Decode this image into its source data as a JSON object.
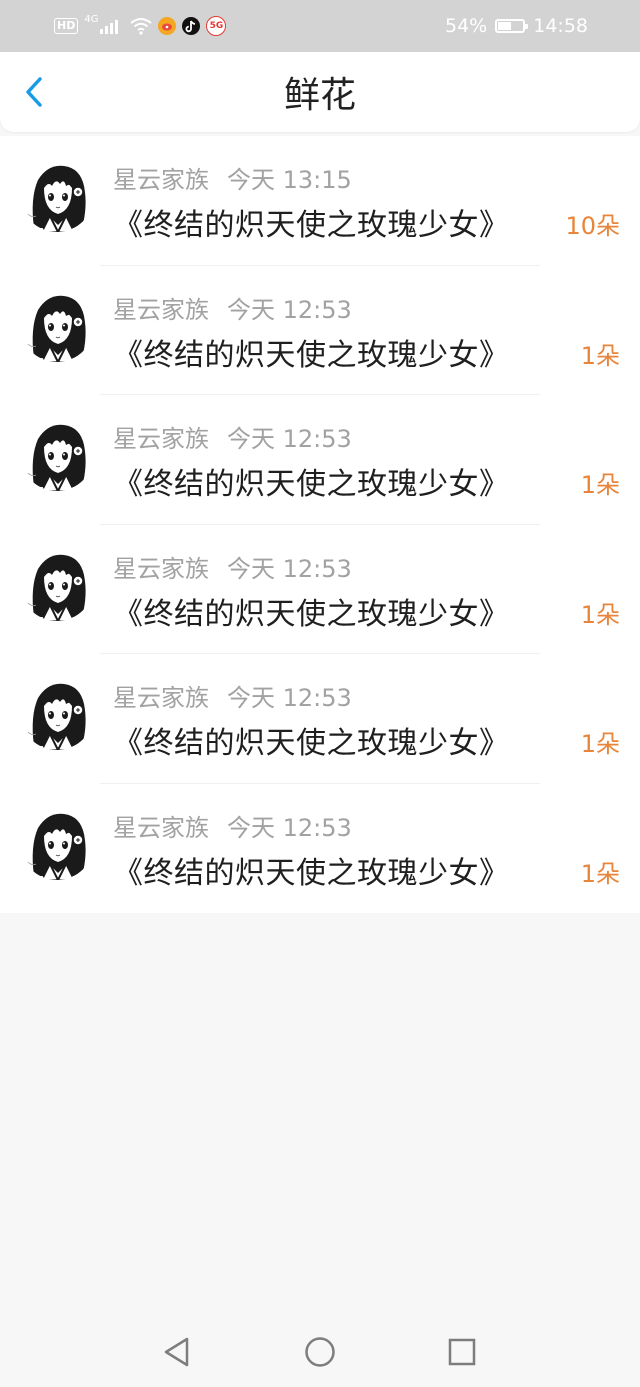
{
  "status_bar": {
    "hd": "HD",
    "network": "4G",
    "battery": "54%",
    "battery_level": 0.54,
    "time": "14:58",
    "app_icons": [
      "weibo-icon",
      "tiktok-icon",
      "5g-icon"
    ],
    "fiveg": "5G"
  },
  "header": {
    "title": "鲜花",
    "back_icon": "chevron-left-icon",
    "accent_color": "#1a9be6"
  },
  "colors": {
    "count": "#e8853a",
    "meta": "#a2a2a2",
    "title": "#1f1f1f"
  },
  "items": [
    {
      "name": "星云家族",
      "time": "今天 13:15",
      "title": "《终结的炽天使之玫瑰少女》",
      "count": "10朵"
    },
    {
      "name": "星云家族",
      "time": "今天 12:53",
      "title": "《终结的炽天使之玫瑰少女》",
      "count": "1朵"
    },
    {
      "name": "星云家族",
      "time": "今天 12:53",
      "title": "《终结的炽天使之玫瑰少女》",
      "count": "1朵"
    },
    {
      "name": "星云家族",
      "time": "今天 12:53",
      "title": "《终结的炽天使之玫瑰少女》",
      "count": "1朵"
    },
    {
      "name": "星云家族",
      "time": "今天 12:53",
      "title": "《终结的炽天使之玫瑰少女》",
      "count": "1朵"
    },
    {
      "name": "星云家族",
      "time": "今天 12:53",
      "title": "《终结的炽天使之玫瑰少女》",
      "count": "1朵"
    }
  ],
  "nav": {
    "back_icon": "triangle-back-icon",
    "home_icon": "circle-home-icon",
    "recents_icon": "square-recents-icon"
  }
}
